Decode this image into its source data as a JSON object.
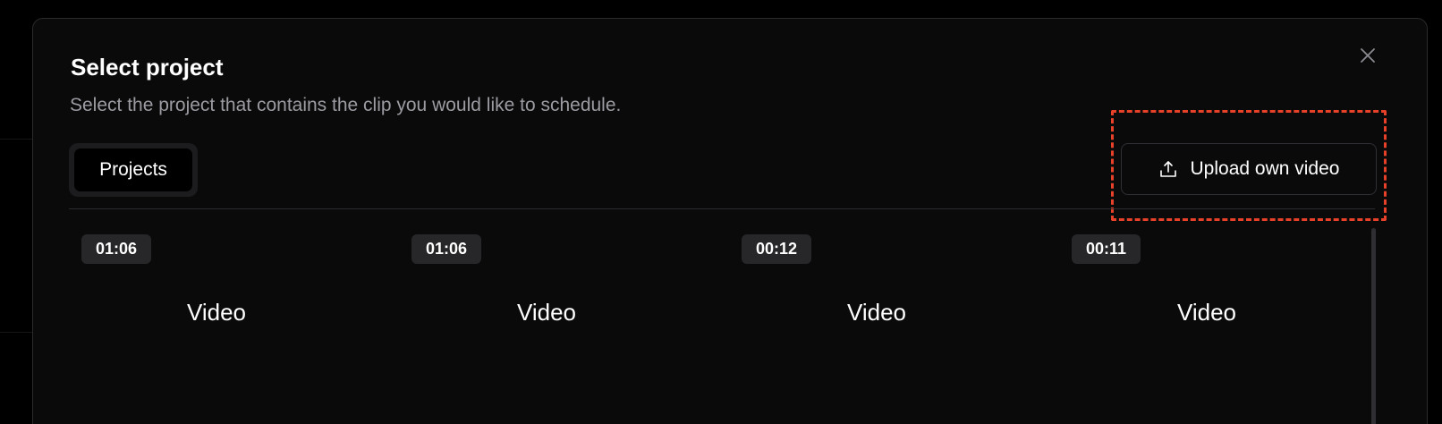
{
  "dialog": {
    "title": "Select project",
    "subtitle": "Select the project that contains the clip you would like to schedule.",
    "close_icon": "close-icon"
  },
  "tabs": [
    {
      "label": "Projects",
      "selected": true
    }
  ],
  "upload": {
    "label": "Upload own video",
    "icon": "upload-icon"
  },
  "highlight_color": "#e8412a",
  "videos": [
    {
      "duration": "01:06",
      "label": "Video"
    },
    {
      "duration": "01:06",
      "label": "Video"
    },
    {
      "duration": "00:12",
      "label": "Video"
    },
    {
      "duration": "00:11",
      "label": "Video"
    }
  ]
}
